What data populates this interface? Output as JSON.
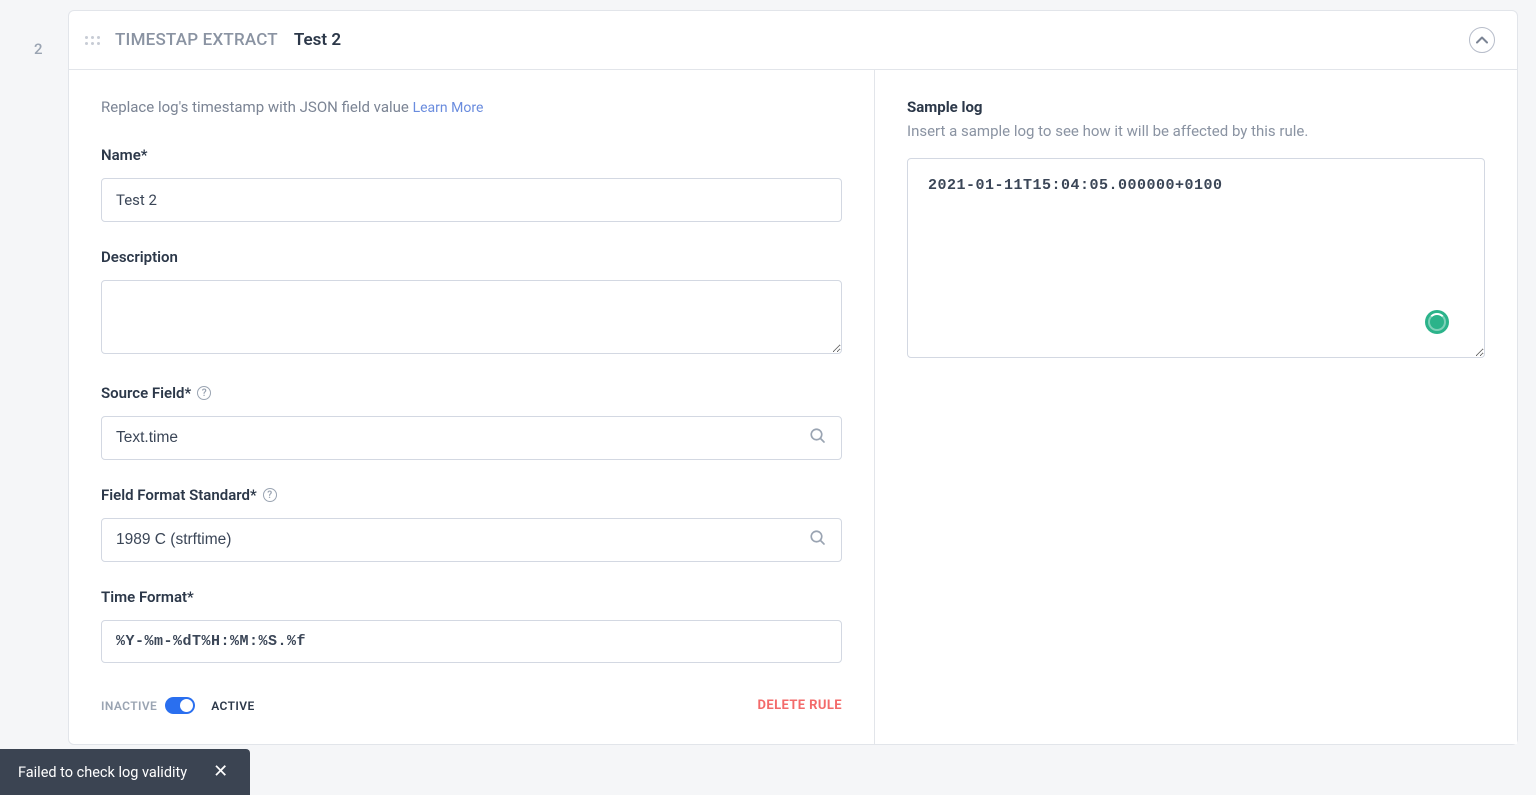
{
  "step_index": "2",
  "header": {
    "type_label": "TIMESTAP EXTRACT",
    "name": "Test 2"
  },
  "intro": {
    "text": "Replace log's timestamp with JSON field value ",
    "learn_more": "Learn More"
  },
  "fields": {
    "name": {
      "label": "Name*",
      "value": "Test 2"
    },
    "description": {
      "label": "Description",
      "value": ""
    },
    "source_field": {
      "label": "Source Field*",
      "value": "Text.time"
    },
    "field_format_standard": {
      "label": "Field Format Standard*",
      "value": "1989 C (strftime)"
    },
    "time_format": {
      "label": "Time Format*",
      "value": "%Y-%m-%dT%H:%M:%S.%f"
    }
  },
  "toggle": {
    "inactive_label": "INACTIVE",
    "active_label": "ACTIVE",
    "is_active": true
  },
  "delete_label": "DELETE RULE",
  "sample": {
    "title": "Sample log",
    "description": "Insert a sample log to see how it will be affected by this rule.",
    "value": "2021-01-11T15:04:05.000000+0100"
  },
  "toast": {
    "message": "Failed to check log validity"
  }
}
